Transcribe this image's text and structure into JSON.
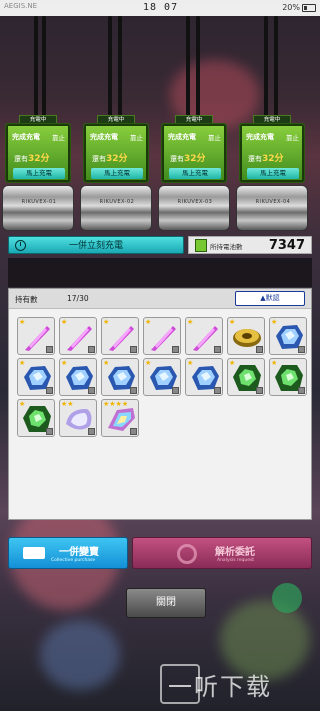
{
  "status": {
    "left": "AEGIS.NE",
    "time": "18 07",
    "battery": "20%"
  },
  "chargers": [
    {
      "tag": "充電中",
      "status": "完成充電",
      "stop": "靠止",
      "remain_prefix": "還有",
      "remain_value": "32分",
      "charge_now": "馬上充電",
      "label": "RIKUVEX-01"
    },
    {
      "tag": "充電中",
      "status": "完成充電",
      "stop": "靠止",
      "remain_prefix": "還有",
      "remain_value": "32分",
      "charge_now": "馬上充電",
      "label": "RIKUVEX-02"
    },
    {
      "tag": "充電中",
      "status": "完成充電",
      "stop": "靠止",
      "remain_prefix": "還有",
      "remain_value": "32分",
      "charge_now": "馬上充電",
      "label": "RIKUVEX-03"
    },
    {
      "tag": "充電中",
      "status": "完成充電",
      "stop": "靠止",
      "remain_prefix": "還有",
      "remain_value": "32分",
      "charge_now": "馬上充電",
      "label": "RIKUVEX-04"
    }
  ],
  "charge_all": "一併立刻充電",
  "battery_count_label": "所持電池數",
  "battery_count": "7347",
  "inventory": {
    "owned_label": "持有數",
    "owned_value": "17/30",
    "sort_label": "▲默認"
  },
  "items": [
    {
      "kind": "pink-crystal",
      "star": "★"
    },
    {
      "kind": "pink-crystal",
      "star": "★"
    },
    {
      "kind": "pink-crystal",
      "star": "★"
    },
    {
      "kind": "pink-crystal",
      "star": "★"
    },
    {
      "kind": "pink-crystal",
      "star": "★"
    },
    {
      "kind": "gold-disc",
      "star": "★"
    },
    {
      "kind": "blue-ore",
      "star": "★"
    },
    {
      "kind": "blue-ore",
      "star": "★"
    },
    {
      "kind": "blue-ore",
      "star": "★"
    },
    {
      "kind": "blue-ore",
      "star": "★"
    },
    {
      "kind": "blue-ore",
      "star": "★"
    },
    {
      "kind": "blue-ore",
      "star": "★"
    },
    {
      "kind": "green-ore",
      "star": "★"
    },
    {
      "kind": "green-ore",
      "star": "★"
    },
    {
      "kind": "green-ore",
      "star": "★"
    },
    {
      "kind": "pearl-shell",
      "star": "★★"
    },
    {
      "kind": "rainbow-shard",
      "star": "★★★★"
    }
  ],
  "collect": {
    "label": "一併變賣",
    "sub": "Collective purchase"
  },
  "analyse": {
    "label": "解析委託",
    "sub": "Analysis request"
  },
  "close_label": "關閉",
  "watermark": "一听下载"
}
